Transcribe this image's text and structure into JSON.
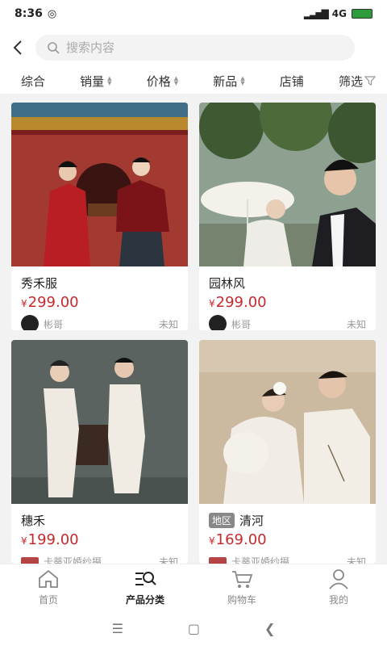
{
  "status_bar": {
    "time": "8:36",
    "network": "4G",
    "battery": ""
  },
  "search": {
    "placeholder": "搜索内容"
  },
  "sort_tabs": [
    {
      "label": "综合"
    },
    {
      "label": "销量"
    },
    {
      "label": "价格"
    },
    {
      "label": "新品"
    },
    {
      "label": "店铺"
    },
    {
      "label": "筛选"
    }
  ],
  "products": [
    {
      "title": "秀禾服",
      "currency": "¥",
      "price": "299.00",
      "seller": "彬哥",
      "location": "未知",
      "region_tag": ""
    },
    {
      "title": "园林风",
      "currency": "¥",
      "price": "299.00",
      "seller": "彬哥",
      "location": "未知",
      "region_tag": ""
    },
    {
      "title": "穗禾",
      "currency": "¥",
      "price": "199.00",
      "seller": "卡蒂亚婚纱摄...",
      "location": "未知",
      "region_tag": ""
    },
    {
      "title": "清河",
      "currency": "¥",
      "price": "169.00",
      "seller": "卡蒂亚婚纱摄...",
      "location": "未知",
      "region_tag": "地区"
    }
  ],
  "tab_bar": [
    {
      "label": "首页",
      "icon": "home-icon"
    },
    {
      "label": "产品分类",
      "icon": "category-search-icon"
    },
    {
      "label": "购物车",
      "icon": "cart-icon"
    },
    {
      "label": "我的",
      "icon": "user-icon"
    }
  ],
  "colors": {
    "price": "#c8292f",
    "active_tab": "#222222",
    "inactive_tab": "#888888"
  }
}
